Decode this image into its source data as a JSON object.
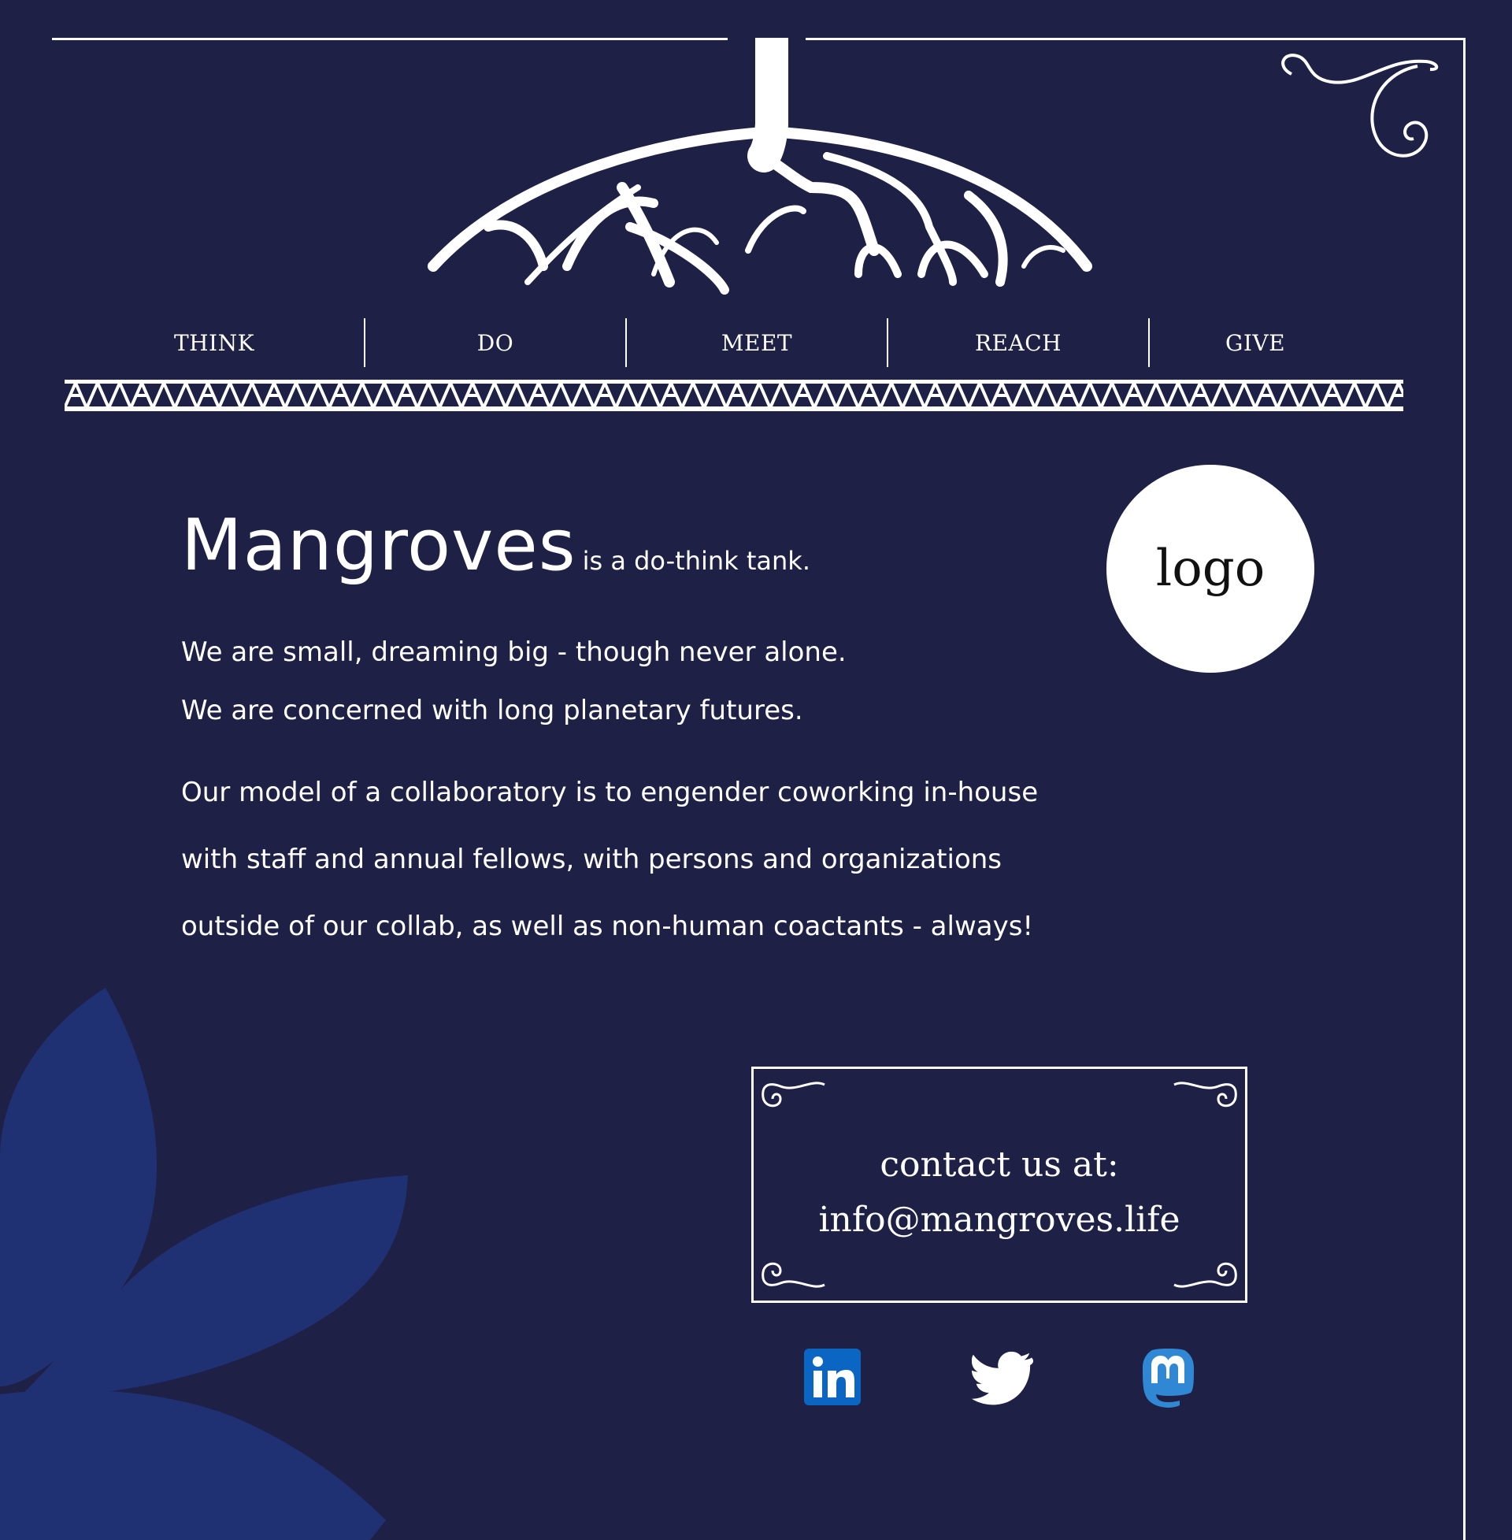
{
  "nav": {
    "items": [
      {
        "label": "THINK"
      },
      {
        "label": "DO"
      },
      {
        "label": "MEET"
      },
      {
        "label": "REACH"
      },
      {
        "label": "GIVE"
      }
    ]
  },
  "intro": {
    "brand": "Mangroves",
    "tagline": "is a do-think tank.",
    "line1": "We are small, dreaming big - though never alone.",
    "line2": "We are concerned with long planetary futures.",
    "para1": "Our model of a collaboratory is to engender coworking in-house",
    "para2": "with staff and annual fellows, with persons and organizations",
    "para3": "outside of our collab, as well as non-human coactants - always!"
  },
  "logo": {
    "text": "logo"
  },
  "contact": {
    "heading": "contact us at:",
    "email": "info@mangroves.life"
  },
  "social": {
    "icons": [
      "linkedin-icon",
      "twitter-icon",
      "mastodon-icon"
    ]
  },
  "colors": {
    "background": "#1e2046",
    "leaf": "#1f3173",
    "linkedin": "#0a66c2",
    "mastodon": "#3088d4",
    "foreground": "#ffffff"
  }
}
